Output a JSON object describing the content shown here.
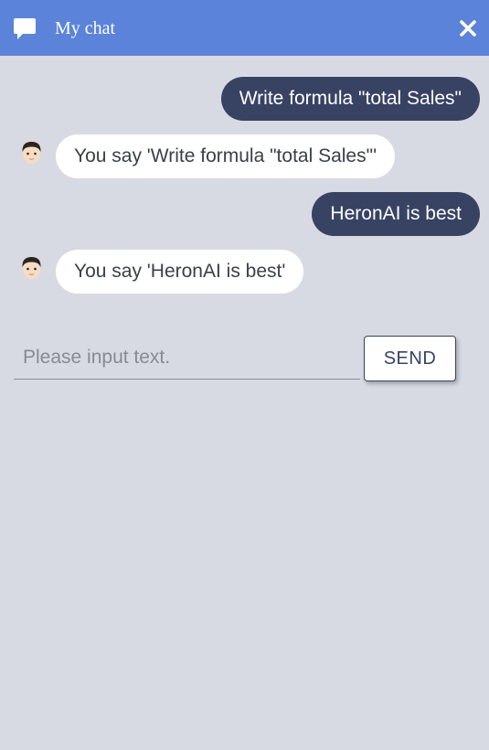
{
  "header": {
    "title": "My chat",
    "chat_icon": "speech-bubble-icon",
    "close_icon": "close-icon",
    "background": "#5b83d9"
  },
  "messages": [
    {
      "sender": "user",
      "text": "Write formula \"total Sales\""
    },
    {
      "sender": "bot",
      "text": "You say 'Write formula \"total Sales\"'",
      "avatar": "avatar-icon"
    },
    {
      "sender": "user",
      "text": "HeronAI is best"
    },
    {
      "sender": "bot",
      "text": "You say 'HeronAI is best'",
      "avatar": "avatar-icon"
    }
  ],
  "composer": {
    "placeholder": "Please input text.",
    "value": "",
    "send_label": "SEND"
  },
  "colors": {
    "background": "#d8dae3",
    "user_bubble": "#384363",
    "bot_bubble": "#ffffff"
  }
}
